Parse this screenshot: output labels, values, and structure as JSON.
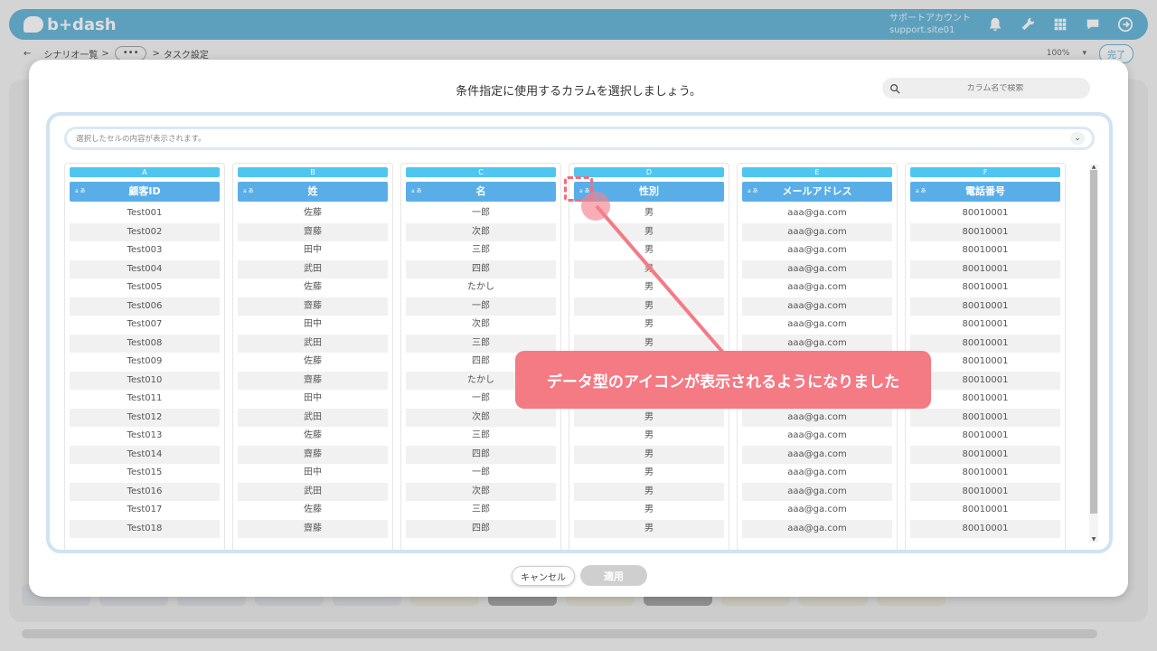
{
  "app": {
    "logo_text": "b+dash",
    "account_label": "サポートアカウント",
    "account_site": "support.site01"
  },
  "header_icons": [
    "bell-icon",
    "wrench-icon",
    "grid-icon",
    "chat-icon",
    "logout-icon"
  ],
  "breadcrumb": {
    "back": "←",
    "scenario_list": "シナリオ一覧",
    "sep1": ">",
    "dots": "•••",
    "sep2": ">",
    "current": "タスク設定"
  },
  "zoom": {
    "value": "100%",
    "chevron": "▾"
  },
  "done_label": "完了",
  "modal": {
    "title": "条件指定に使用するカラムを選択しましょう。",
    "search_placeholder": "カラム名で検索",
    "cell_display_placeholder": "選択したセルの内容が表示されます。",
    "cancel_label": "キャンセル",
    "apply_label": "適用"
  },
  "type_icon_label": "a あ",
  "columns": [
    {
      "letter": "A",
      "name": "顧客ID",
      "cells": [
        "Test001",
        "Test002",
        "Test003",
        "Test004",
        "Test005",
        "Test006",
        "Test007",
        "Test008",
        "Test009",
        "Test010",
        "Test011",
        "Test012",
        "Test013",
        "Test014",
        "Test015",
        "Test016",
        "Test017",
        "Test018"
      ]
    },
    {
      "letter": "B",
      "name": "姓",
      "cells": [
        "佐藤",
        "齋藤",
        "田中",
        "武田",
        "佐藤",
        "齋藤",
        "田中",
        "武田",
        "佐藤",
        "齋藤",
        "田中",
        "武田",
        "佐藤",
        "齋藤",
        "田中",
        "武田",
        "佐藤",
        "齋藤"
      ]
    },
    {
      "letter": "C",
      "name": "名",
      "cells": [
        "一郎",
        "次郎",
        "三郎",
        "四郎",
        "たかし",
        "一郎",
        "次郎",
        "三郎",
        "四郎",
        "たかし",
        "一郎",
        "次郎",
        "三郎",
        "四郎",
        "一郎",
        "次郎",
        "三郎",
        "四郎"
      ]
    },
    {
      "letter": "D",
      "name": "性別",
      "cells": [
        "男",
        "男",
        "男",
        "男",
        "男",
        "男",
        "男",
        "男",
        "",
        "",
        "",
        "男",
        "男",
        "男",
        "男",
        "男",
        "男",
        "男"
      ]
    },
    {
      "letter": "E",
      "name": "メールアドレス",
      "cells": [
        "aaa@ga.com",
        "aaa@ga.com",
        "aaa@ga.com",
        "aaa@ga.com",
        "aaa@ga.com",
        "aaa@ga.com",
        "aaa@ga.com",
        "aaa@ga.com",
        "",
        "",
        "",
        "aaa@ga.com",
        "aaa@ga.com",
        "aaa@ga.com",
        "aaa@ga.com",
        "aaa@ga.com",
        "aaa@ga.com",
        "aaa@ga.com"
      ]
    },
    {
      "letter": "F",
      "name": "電話番号",
      "cells": [
        "80010001",
        "80010001",
        "80010001",
        "80010001",
        "80010001",
        "80010001",
        "80010001",
        "80010001",
        "80010001",
        "80010001",
        "80010001",
        "80010001",
        "80010001",
        "80010001",
        "80010001",
        "80010001",
        "80010001",
        "80010001"
      ]
    }
  ],
  "callout_text": "データ型のアイコンが表示されるようになりました",
  "colors": {
    "header": "#55aed6",
    "column_letter": "#4fc6f0",
    "column_head": "#5aaee8",
    "annotation": "#f47a84"
  }
}
